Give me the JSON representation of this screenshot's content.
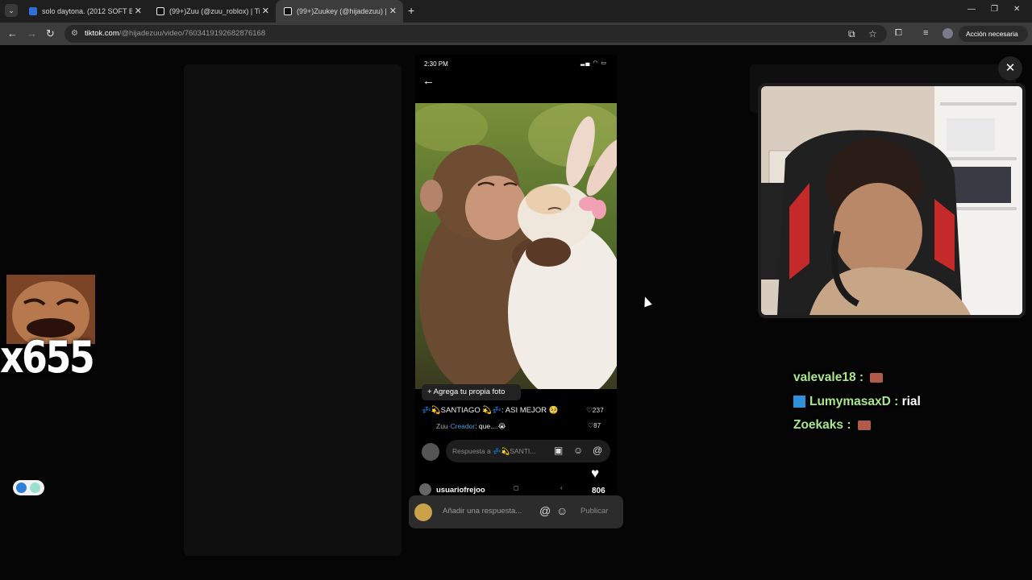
{
  "browser": {
    "tabs": [
      {
        "title": "solo daytona. (2012 SOFT BODY",
        "active": false
      },
      {
        "title": "(99+)Zuu (@zuu_roblox) | TikTo",
        "active": false
      },
      {
        "title": "(99+)Zuukey (@hijadezuu) | TikT",
        "active": true
      }
    ],
    "url_domain": "tiktok.com",
    "url_path": "/@hijadezuu/video/7603419192682876168",
    "action_button": "Acción necesaria"
  },
  "phone": {
    "status_time": "2:30 PM",
    "add_photo_label": "+ Agrega tu propia foto",
    "comments": [
      {
        "text": "💤💫SANTIAGO 💫💤: ASI MEJOR 🥺",
        "likes": "237"
      },
      {
        "user": "Zuu",
        "role": "·Creador",
        "text": ": que....😭",
        "likes": "87"
      }
    ],
    "reply_placeholder": "Respuesta a 💤💫SANTI...",
    "like_count": "806",
    "username": "usuariofrejoo"
  },
  "comment_bar": {
    "placeholder": "Añadir una respuesta...",
    "publish_label": "Publicar"
  },
  "overlay": {
    "chat": [
      {
        "user": "valevale18",
        "sep": " : ",
        "msg": "",
        "emote": true,
        "badge": false
      },
      {
        "user": "LumymasaxD",
        "sep": " : ",
        "msg": "rial",
        "emote": false,
        "badge": true
      },
      {
        "user": "Zoekaks",
        "sep": " : ",
        "msg": "",
        "emote": true,
        "badge": false
      }
    ],
    "combo_text": "x655"
  },
  "colors": {
    "chat_name": "#a8e88a",
    "creator_blue": "#3aa1d8",
    "tiktok_bg": "#000000"
  }
}
